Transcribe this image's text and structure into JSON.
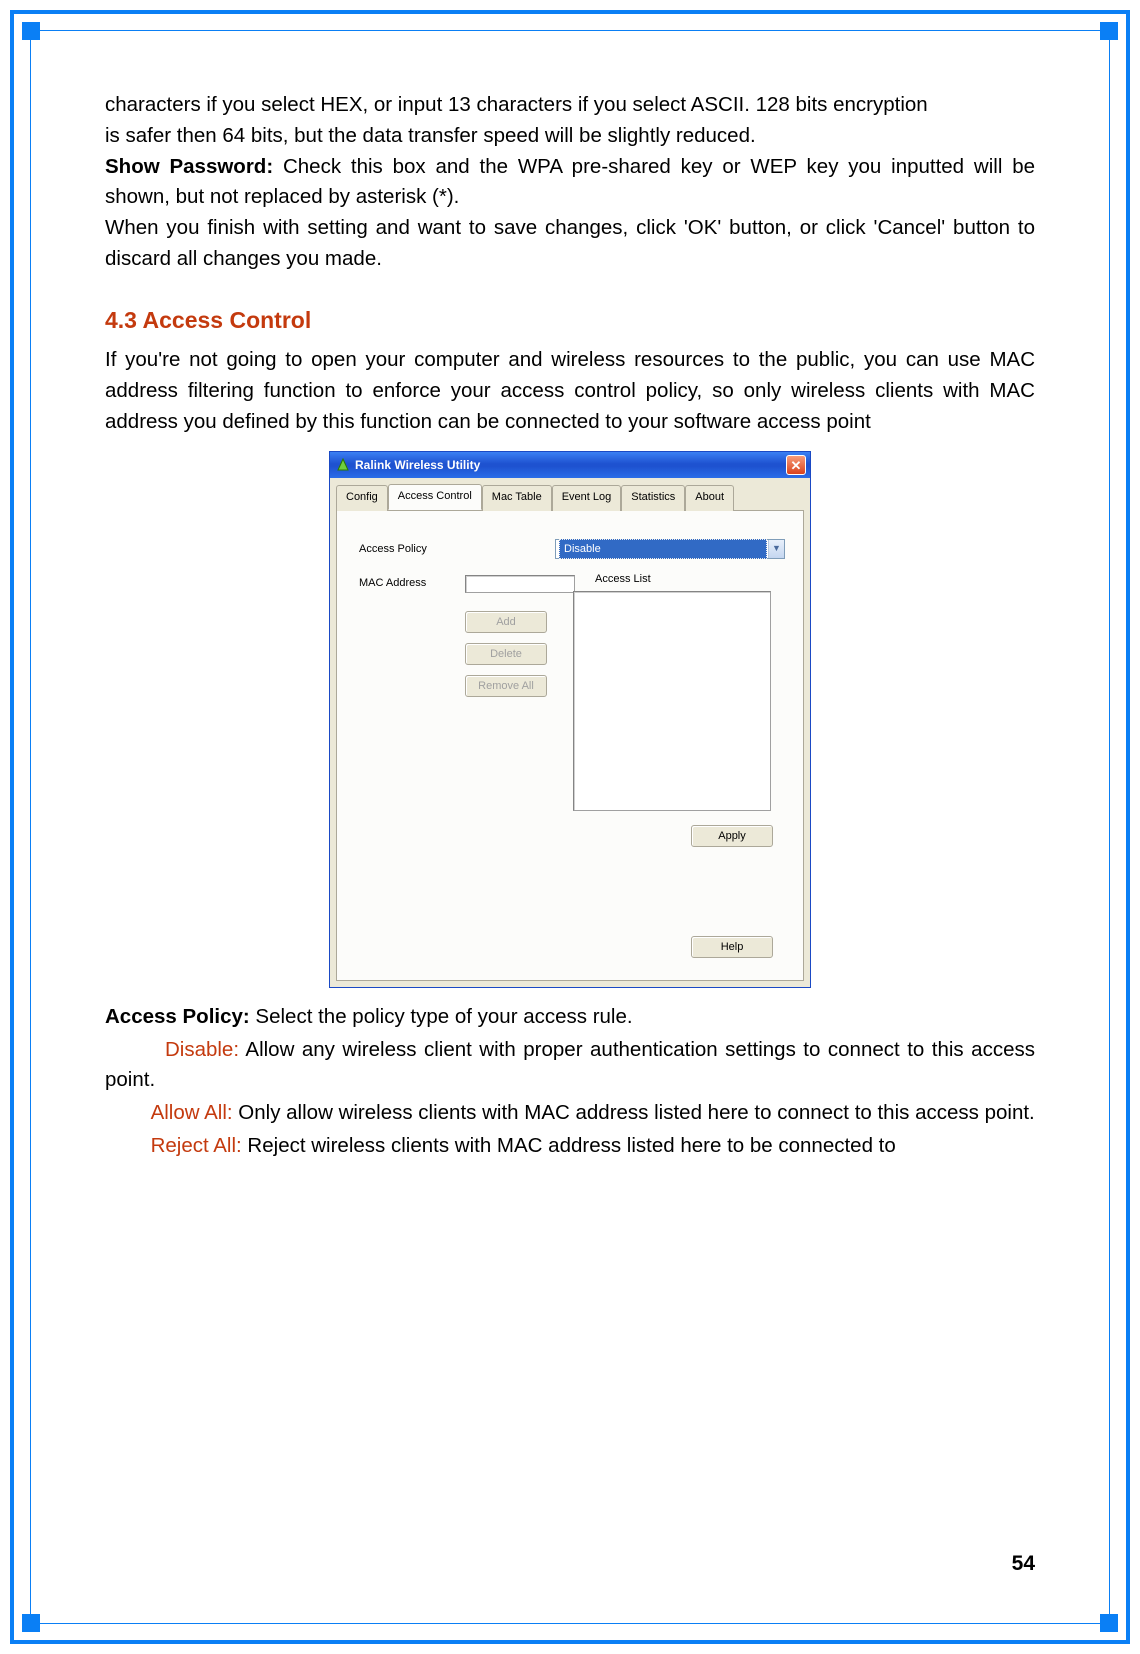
{
  "body": {
    "p1": "characters if you select HEX, or input 13 characters if you select ASCII. 128 bits encryption",
    "p2": "is safer then 64 bits, but the data transfer speed will be slightly reduced.",
    "p3_bold": "Show Password:",
    "p3_rest": " Check this box and the WPA pre-shared key or WEP key you inputted will be shown, but not replaced by asterisk (*).",
    "p4": "When you finish with setting and want to save changes, click 'OK' button, or click 'Cancel' button to discard all changes you made.",
    "heading": "4.3 Access Control",
    "p5": "If you're not going to open your computer and wireless resources to the public, you can use MAC address filtering function to enforce your access control policy, so only wireless clients with MAC address you defined by this function can be connected to your software access point",
    "ap_bold": "Access Policy:",
    "ap_rest": " Select the policy type of your access rule.",
    "disable_label": "Disable:",
    "disable_text": " Allow any wireless client with proper authentication settings to connect to this   access point.",
    "allow_label": "Allow All:",
    "allow_text": " Only allow wireless clients with MAC address listed here to connect to this   access point.",
    "reject_label": "Reject All:",
    "reject_text": " Reject wireless clients with MAC address listed here to be connected to"
  },
  "window": {
    "title": "Ralink Wireless Utility",
    "tabs": [
      "Config",
      "Access Control",
      "Mac Table",
      "Event Log",
      "Statistics",
      "About"
    ],
    "active_tab": "Access Control",
    "access_policy_label": "Access Policy",
    "access_policy_value": "Disable",
    "mac_address_label": "MAC Address",
    "access_list_label": "Access List",
    "buttons": {
      "add": "Add",
      "delete": "Delete",
      "remove_all": "Remove All",
      "apply": "Apply",
      "help": "Help"
    }
  },
  "page_number": "54"
}
